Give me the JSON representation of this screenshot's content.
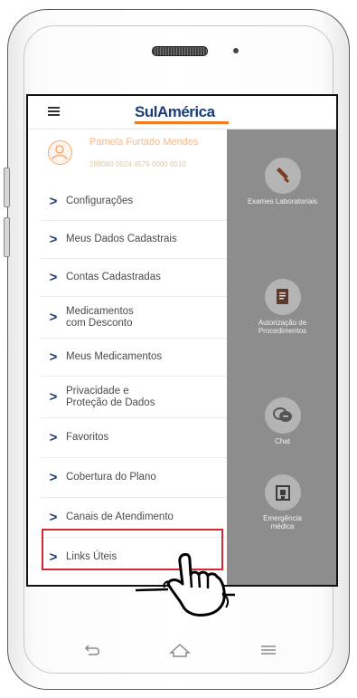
{
  "brand": {
    "name": "SulAmérica",
    "accent": "#f47920",
    "primary": "#1a3d7c"
  },
  "user": {
    "name": "Pamela Furtado Mendes",
    "id_line": "288080 0024 4579 0000 0010"
  },
  "menu": {
    "items": [
      {
        "label": "Configurações"
      },
      {
        "label": "Meus Dados Cadastrais"
      },
      {
        "label": "Contas Cadastradas"
      },
      {
        "label": "Medicamentos\ncom Desconto"
      },
      {
        "label": "Meus Medicamentos"
      },
      {
        "label": "Privacidade e\nProteção de Dados"
      },
      {
        "label": "Favoritos"
      },
      {
        "label": "Cobertura do Plano"
      },
      {
        "label": "Canais de Atendimento"
      },
      {
        "label": "Links Úteis"
      }
    ]
  },
  "quick_actions": [
    {
      "label": "Exames Laboratoriais",
      "icon": "test-tube-icon"
    },
    {
      "label": "Autorização de\nProcedimentos",
      "icon": "document-icon"
    },
    {
      "label": "Chat",
      "icon": "chat-icon"
    },
    {
      "label": "Emergência\nmédica",
      "icon": "hospital-icon"
    }
  ],
  "highlight_color": "#d5282f",
  "device_nav": [
    "back-icon",
    "home-icon",
    "menu-icon"
  ]
}
